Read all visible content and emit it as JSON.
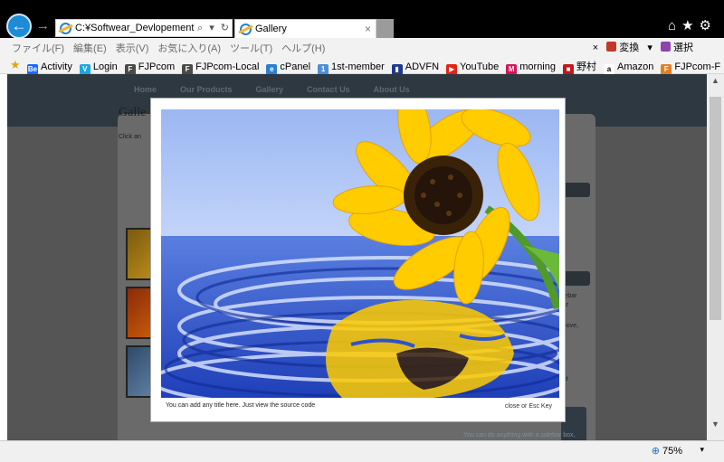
{
  "browser": {
    "address": "C:¥Softwear_Devlopement¥\\",
    "address_controls": "⌕ ▾ ↻",
    "tab_title": "Gallery",
    "tab_close": "×",
    "top_icons": "⌂★⚙",
    "back_glyph": "←",
    "forward_glyph": "→"
  },
  "menu": {
    "items": [
      "ファイル(F)",
      "編集(E)",
      "表示(V)",
      "お気に入り(A)",
      "ツール(T)",
      "ヘルプ(H)"
    ],
    "close": "×",
    "convert": "変換",
    "convert_caret": "▾",
    "select": "選択"
  },
  "favorites": [
    {
      "label": "Activity",
      "icon": "behance-icon",
      "color": "#1769ff",
      "glyph": "Be"
    },
    {
      "label": "Login",
      "icon": "vimeo-icon",
      "color": "#1aa7e6",
      "glyph": "V"
    },
    {
      "label": "FJPcom",
      "icon": "site-icon",
      "color": "#4a4a4a",
      "glyph": "F"
    },
    {
      "label": "FJPcom-Local",
      "icon": "site-icon",
      "color": "#4a4a4a",
      "glyph": "F"
    },
    {
      "label": "cPanel",
      "icon": "ie-icon",
      "color": "#2a7fd4",
      "glyph": "e"
    },
    {
      "label": "1st-member",
      "icon": "member-icon",
      "color": "#4a90d9",
      "glyph": "1"
    },
    {
      "label": "ADVFN",
      "icon": "bar-chart-icon",
      "color": "#1f3a93",
      "glyph": "▮"
    },
    {
      "label": "YouTube",
      "icon": "youtube-icon",
      "color": "#e62117",
      "glyph": "▶"
    },
    {
      "label": "morning",
      "icon": "morning-icon",
      "color": "#d4145a",
      "glyph": "M"
    },
    {
      "label": "野村",
      "icon": "nomura-icon",
      "color": "#c4161c",
      "glyph": "■"
    },
    {
      "label": "Amazon",
      "icon": "amazon-icon",
      "color": "#ffffff",
      "glyph": "a"
    },
    {
      "label": "FJPcom-F",
      "icon": "fjpcom-f-icon",
      "color": "#e67e22",
      "glyph": "F"
    }
  ],
  "site": {
    "nav": [
      "Home",
      "Our Products",
      "Gallery",
      "Contact Us",
      "About Us"
    ],
    "heading": "Galle",
    "subtext": "Click an",
    "sidebar": [
      "idebar",
      "our",
      "above,",
      "ox",
      "ent",
      "You can do anything with a sidebar box,"
    ]
  },
  "lightbox": {
    "caption": "You can add any title here. Just view the source code",
    "close": "close or Esc Key"
  },
  "status": {
    "zoom": "75%",
    "zoom_caret": "▾"
  },
  "scroll": {
    "up": "▲",
    "down": "▼"
  },
  "colors": {
    "chrome": "#000000",
    "accent": "#1e8bd6",
    "overlay": "#555555"
  }
}
